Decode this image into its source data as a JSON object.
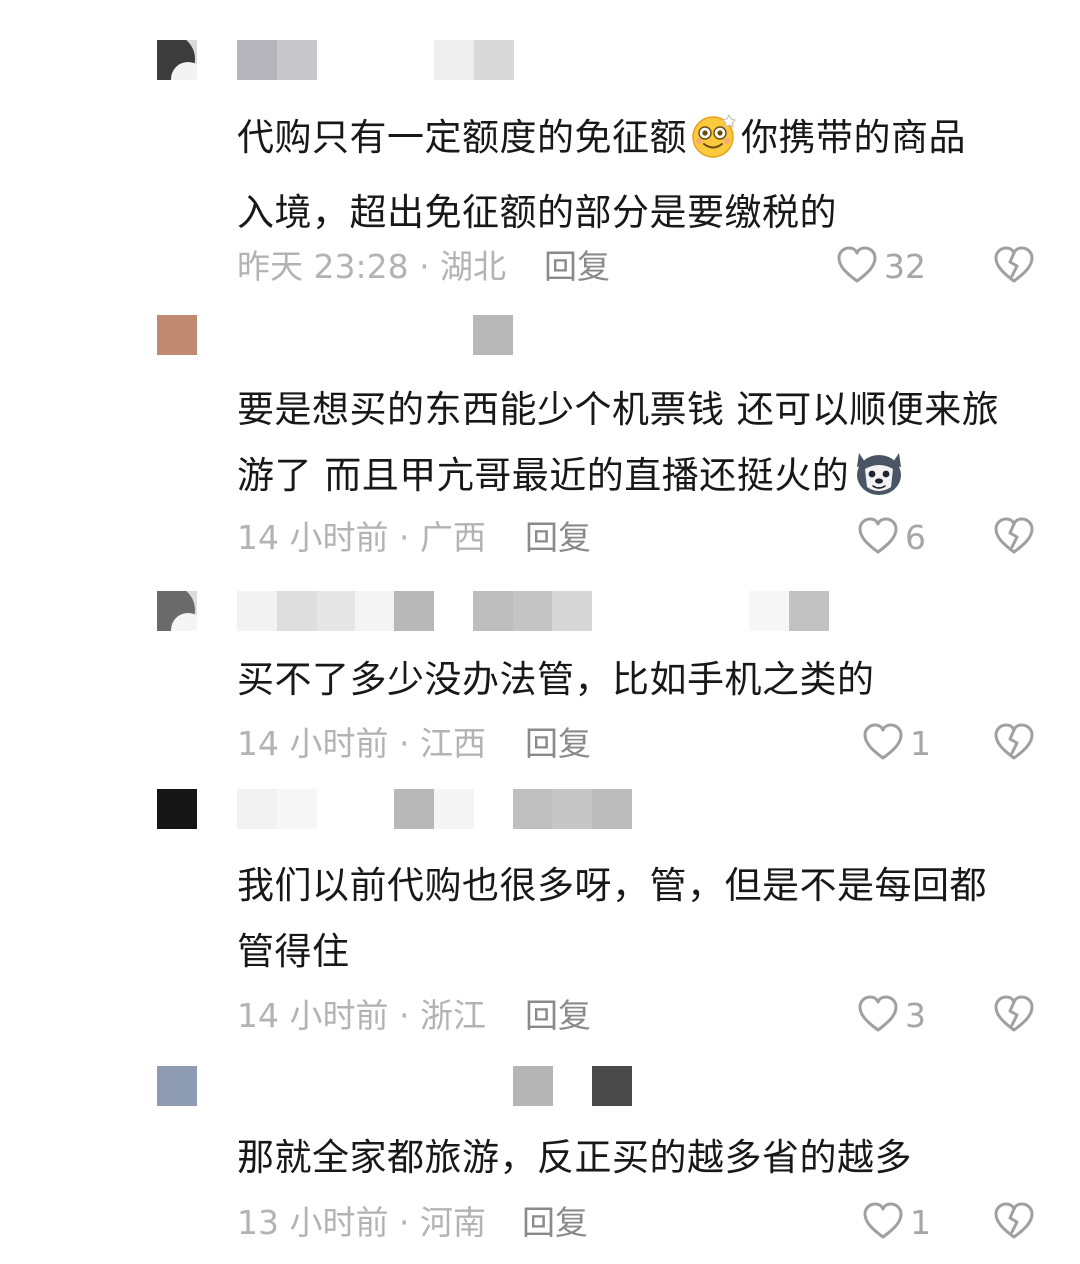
{
  "comments": [
    {
      "text_lines": [
        "代购只有一定额度的免征额",
        "你携带的商品",
        "入境，超出免征额的部分是要缴税的"
      ],
      "meta": "昨天 23:28 · 湖北",
      "reply_label": "回复",
      "likes": "32",
      "avatar_color": "#3c3c3c",
      "emoji": "dizzy-face-emoji"
    },
    {
      "text_lines": [
        "要是想买的东西能少个机票钱 还可以顺便来旅",
        "游了 而且甲亢哥最近的直播还挺火的"
      ],
      "meta": "14 小时前 · 广西",
      "reply_label": "回复",
      "likes": "6",
      "avatar_color": "#c08a70",
      "emoji": "husky-dog-emoji"
    },
    {
      "text_lines": [
        "买不了多少没办法管，比如手机之类的"
      ],
      "meta": "14 小时前 · 江西",
      "reply_label": "回复",
      "likes": "1",
      "avatar_color": "#6a6a6a"
    },
    {
      "text_lines": [
        "我们以前代购也很多呀，管，但是不是每回都",
        "管得住"
      ],
      "meta": "14 小时前 · 浙江",
      "reply_label": "回复",
      "likes": "3",
      "avatar_color": "#151515"
    },
    {
      "text_lines": [
        "那就全家都旅游，反正买的越多省的越多"
      ],
      "meta": "13 小时前 · 河南",
      "reply_label": "回复",
      "likes": "1",
      "avatar_color": "#8e9cb3"
    }
  ],
  "icons": {
    "like": "heart-outline-icon",
    "dislike": "broken-heart-icon"
  },
  "colors": {
    "text": "#181818",
    "meta": "#b3b3b3",
    "reply": "#8a8a8a",
    "icon": "#a0a0a0",
    "background": "#ffffff"
  }
}
